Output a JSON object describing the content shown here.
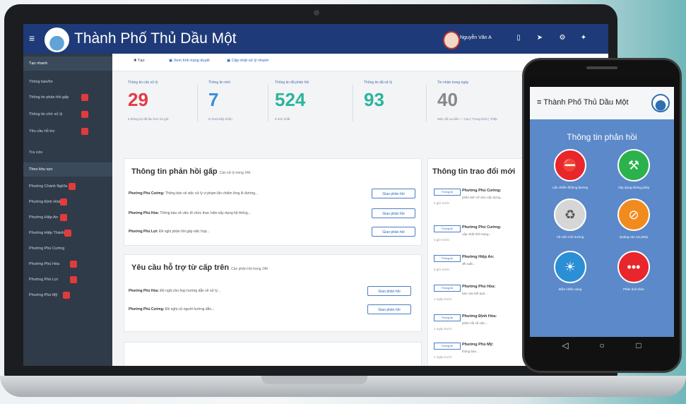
{
  "app": {
    "title": "Thành Phố Thủ Dầu Một",
    "user_name": "Nguyễn Văn A"
  },
  "sidebar": {
    "items": [
      {
        "label": "Tạo nhanh"
      },
      {
        "label": "Thông báo/tin"
      },
      {
        "label": "Thông tin phản hồi gấp"
      },
      {
        "label": "Thông tin chờ xử lý"
      },
      {
        "label": "Yêu cầu hỗ trợ"
      },
      {
        "label": "Tra cứu"
      },
      {
        "label": "Theo khu vực"
      },
      {
        "label": "Phường Chánh Nghĩa"
      },
      {
        "label": "Phường Định Hòa"
      },
      {
        "label": "Phường Hiệp An"
      },
      {
        "label": "Phường Hiệp Thành"
      },
      {
        "label": "Phường Phú Cường"
      },
      {
        "label": "Phường Phú Hòa"
      },
      {
        "label": "Phường Phú Lợi"
      },
      {
        "label": "Phường Phú Mỹ"
      }
    ]
  },
  "toolbar": {
    "add": "Tạo",
    "link1": "Xem tình trạng duyệt",
    "link2": "Cập nhật xử lý nhanh"
  },
  "stats": [
    {
      "label": "Thông tin cần xử lý",
      "value": "29",
      "sub": "6 thông tin đã lâu hơn 24 giờ",
      "color": "#e23b47"
    },
    {
      "label": "Thông tin mới",
      "value": "7",
      "sub": "5 chưa tiếp nhận",
      "color": "#3a8ed6"
    },
    {
      "label": "Thông tin đã phản hồi",
      "value": "524",
      "sub": "5 mới nhất",
      "color": "#2bb59a"
    },
    {
      "label": "Thông tin đã xử lý",
      "value": "93",
      "sub": "",
      "color": "#2bb59a"
    },
    {
      "label": "Tin nhận trong ngày",
      "value": "40",
      "sub": "Mức độ ưu tiên — Cao | Trung bình | Thấp",
      "color": "#888888"
    }
  ],
  "panels": {
    "urgent": {
      "title": "Thông tin phản hồi gấp",
      "subtitle": "Cần xử lý trong 24h",
      "rows": [
        {
          "name": "Phường Phú Cường:",
          "text": "Thông báo về việc xử lý vi phạm lấn chiếm lòng lề đường...",
          "button": "Giao phản hồi"
        },
        {
          "name": "Phường Phú Hòa:",
          "text": "Thông báo về việc tổ chức thực hiện xây dựng hệ thống...",
          "button": "Giao phản hồi"
        },
        {
          "name": "Phường Phú Lợi:",
          "text": "Đề nghị phản hồi gấp việc họp...",
          "button": "Giao phản hồi"
        }
      ]
    },
    "support": {
      "title": "Yêu cầu hỗ trợ từ cấp trên",
      "subtitle": "Cần phản hồi trong 24h",
      "rows": [
        {
          "name": "Phường Phú Hòa:",
          "text": "Đề nghị cho họp hướng dẫn về xử lý...",
          "button": "Giao phản hồi"
        },
        {
          "name": "Phường Phú Cường:",
          "text": "Đề nghị cử người hướng dẫn...",
          "button": "Giao phản hồi"
        }
      ]
    },
    "exchange": {
      "title": "Thông tin trao đổi mới",
      "items": [
        {
          "tag": "Thông tin",
          "name": "Phường Phú Cường:",
          "line": "phản ánh về việc xây dựng...",
          "time": "2 giờ trước"
        },
        {
          "tag": "Thông tin",
          "name": "Phường Phú Cường:",
          "line": "cập nhật tình trạng...",
          "time": "3 giờ trước"
        },
        {
          "tag": "Thông tin",
          "name": "Phường Hiệp An:",
          "line": "đề xuất...",
          "time": "5 giờ trước"
        },
        {
          "tag": "Thông tin",
          "name": "Phường Phú Hòa:",
          "line": "báo cáo kết quả...",
          "time": "1 ngày trước"
        },
        {
          "tag": "Thông tin",
          "name": "Phường Định Hòa:",
          "line": "phản hồi về việc...",
          "time": "1 ngày trước"
        },
        {
          "tag": "Thông tin",
          "name": "Phường Phú Mỹ:",
          "line": "thông báo...",
          "time": "2 ngày trước"
        }
      ]
    }
  },
  "phone": {
    "title": "Thành Phố Thủ Dầu Một",
    "heading": "Thông tin phản hồi",
    "tiles": [
      {
        "label": "Lấn chiếm lề/lòng đường",
        "color": "#e8262b",
        "icon": "sidewalk-icon"
      },
      {
        "label": "Xây dựng không phép",
        "color": "#2bb24c",
        "icon": "construction-icon"
      },
      {
        "label": "Vệ sinh môi trường",
        "color": "#d6d6d6",
        "icon": "garbage-icon"
      },
      {
        "label": "Quảng cáo sai phép",
        "color": "#f28b1e",
        "icon": "no-ads-icon"
      },
      {
        "label": "Điện chiếu sáng",
        "color": "#2b8fd6",
        "icon": "lighting-icon"
      },
      {
        "label": "Phản ánh khác",
        "color": "#e8262b",
        "icon": "more-icon"
      }
    ]
  }
}
